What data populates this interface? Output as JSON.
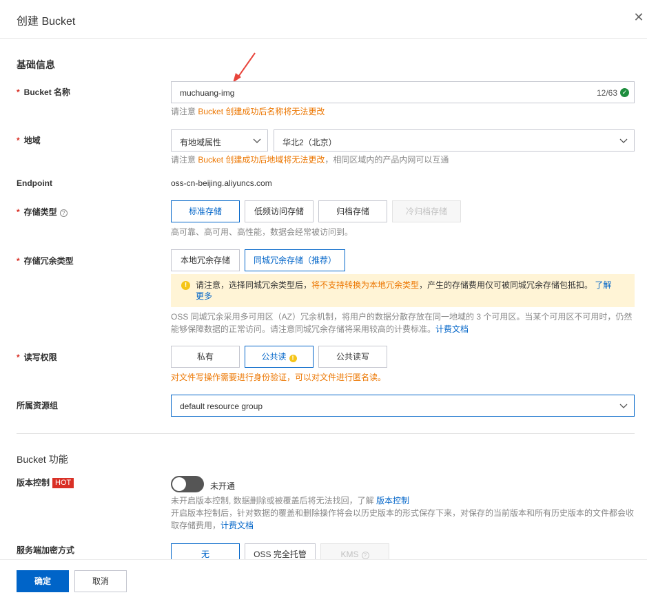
{
  "header": {
    "title": "创建 Bucket",
    "close_icon": "close-icon"
  },
  "basic": {
    "section_title": "基础信息",
    "bucket_name": {
      "label": "Bucket 名称",
      "value": "muchuang-img",
      "counter": "12/63",
      "hint_prefix": "请注意 ",
      "hint_orange": "Bucket 创建成功后名称将无法更改"
    },
    "region": {
      "label": "地域",
      "type_value": "有地域属性",
      "region_value": "华北2（北京）",
      "hint_prefix": "请注意 ",
      "hint_orange": "Bucket 创建成功后地域将无法更改",
      "hint_suffix": "，相同区域内的产品内网可以互通"
    },
    "endpoint": {
      "label": "Endpoint",
      "value": "oss-cn-beijing.aliyuncs.com"
    },
    "storage_class": {
      "label": "存储类型",
      "options": [
        "标准存储",
        "低频访问存储",
        "归档存储",
        "冷归档存储"
      ],
      "selected": 0,
      "hint": "高可靠、高可用、高性能，数据会经常被访问到。"
    },
    "redundancy": {
      "label": "存储冗余类型",
      "options": [
        "本地冗余存储",
        "同城冗余存储（推荐）"
      ],
      "selected": 1,
      "notice_prefix": "请注意，选择同城冗余类型后，",
      "notice_orange": "将不支持转换为本地冗余类型",
      "notice_mid": "，产生的存储费用仅可被同城冗余存储包抵扣。",
      "notice_link_1": "了解",
      "notice_link_2": "更多",
      "desc_line1": "OSS 同城冗余采用多可用区（AZ）冗余机制，将用户的数据分散存放在同一地域的 3 个可用区。当某个可用区不可用时，仍然",
      "desc_line2": "能够保障数据的正常访问。请注意同城冗余存储将采用较高的计费标准。",
      "desc_link": "计费文档"
    },
    "acl": {
      "label": "读写权限",
      "options": [
        "私有",
        "公共读",
        "公共读写"
      ],
      "selected": 1,
      "hint": "对文件写操作需要进行身份验证，可以对文件进行匿名读。"
    },
    "resource_group": {
      "label": "所属资源组",
      "value": "default resource group"
    }
  },
  "features": {
    "section_title": "Bucket 功能",
    "versioning": {
      "label": "版本控制",
      "badge": "HOT",
      "status": "未开通",
      "enabled": false,
      "hint_line1_prefix": "未开启版本控制, 数据删除或被覆盖后将无法找回，了解 ",
      "hint_line1_link": "版本控制",
      "hint_line2": "开启版本控制后，针对数据的覆盖和删除操作将会以历史版本的形式保存下来，对保存的当前版本和所有历史版本的文件都会收",
      "hint_line3_prefix": "取存储费用，",
      "hint_line3_link": "计费文档"
    },
    "encryption": {
      "label": "服务端加密方式",
      "options": [
        "无",
        "OSS 完全托管",
        "KMS"
      ],
      "selected": 0
    }
  },
  "footer": {
    "ok": "确定",
    "cancel": "取消"
  }
}
